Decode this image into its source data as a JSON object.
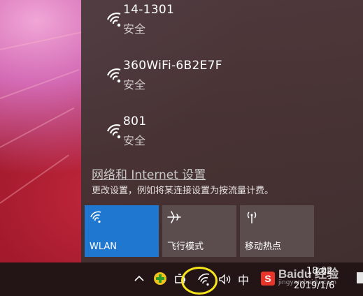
{
  "networks": [
    {
      "name": "14-1301",
      "status": "安全"
    },
    {
      "name": "360WiFi-6B2E7F",
      "status": "安全"
    },
    {
      "name": "801",
      "status": "安全"
    }
  ],
  "settings": {
    "link_label": "网络和 Internet 设置",
    "description": "更改设置，例如将某连接设置为按流量计费。"
  },
  "quick_actions": {
    "wlan_label": "WLAN",
    "airplane_label": "飞行模式",
    "hotspot_label": "移动热点"
  },
  "taskbar": {
    "ime_label": "中",
    "sogou_label": "S",
    "time": "18:02",
    "date": "2019/1/6"
  },
  "watermark": {
    "brand": "Baidu 经验",
    "sub": "jingyan.baidu.com"
  },
  "colors": {
    "wlan_tile": "#1f77d0",
    "tile_inactive": "#5b4d4d",
    "highlight_ring": "#f5e51a"
  }
}
